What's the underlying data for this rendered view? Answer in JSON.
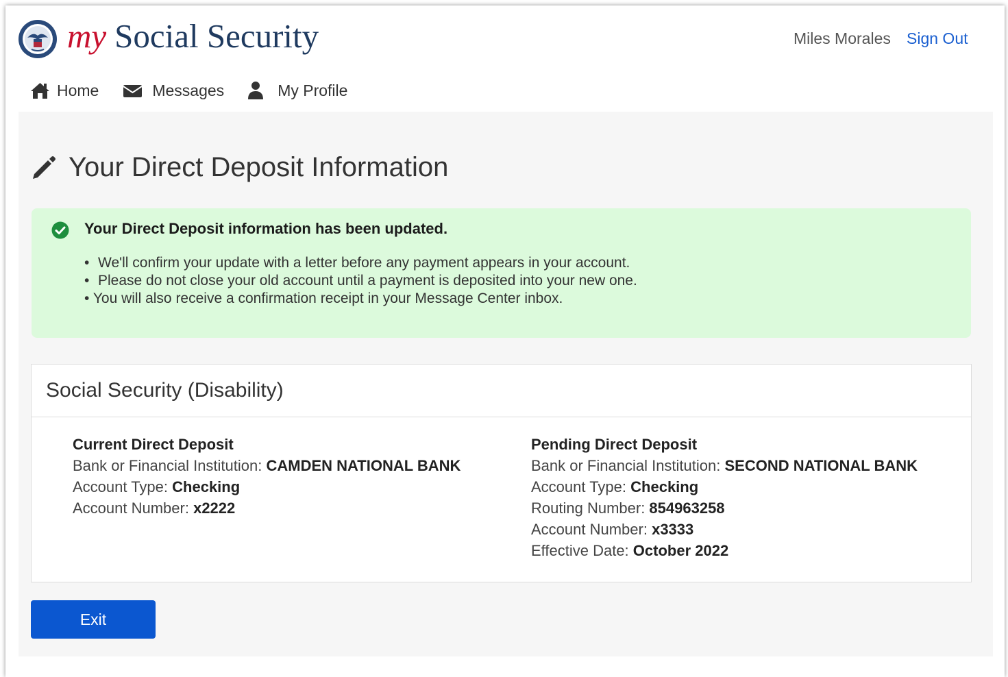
{
  "header": {
    "brand_my": "my",
    "brand_rest": "Social Security",
    "user_name": "Miles Morales",
    "sign_out": "Sign Out"
  },
  "nav": {
    "home": "Home",
    "messages": "Messages",
    "profile": "My Profile"
  },
  "page": {
    "title": "Your Direct Deposit Information"
  },
  "alert": {
    "heading": "Your Direct Deposit information has been updated.",
    "bullets": [
      "We'll confirm your update with a letter before any payment appears in your account.",
      "Please do not close your old account until a payment is deposited into your new one.",
      "You will also receive a confirmation receipt in your Message Center inbox."
    ]
  },
  "card": {
    "title": "Social Security (Disability)",
    "current": {
      "heading": "Current Direct Deposit",
      "bank_label": "Bank or Financial Institution: ",
      "bank_value": "CAMDEN NATIONAL BANK",
      "type_label": "Account Type: ",
      "type_value": "Checking",
      "acct_label": "Account Number: ",
      "acct_value": "x2222"
    },
    "pending": {
      "heading": "Pending Direct Deposit",
      "bank_label": "Bank or Financial Institution: ",
      "bank_value": "SECOND NATIONAL BANK",
      "type_label": "Account Type: ",
      "type_value": "Checking",
      "routing_label": "Routing Number: ",
      "routing_value": "854963258",
      "acct_label": "Account Number: ",
      "acct_value": "x3333",
      "date_label": "Effective Date: ",
      "date_value": "October 2022"
    }
  },
  "actions": {
    "exit": "Exit"
  },
  "colors": {
    "brand_red": "#c8102e",
    "brand_navy": "#1f3a5f",
    "link_blue": "#1a5fd0",
    "button_blue": "#0b57d0",
    "success_bg": "#dcfadc",
    "success_icon": "#1e8e3e"
  }
}
